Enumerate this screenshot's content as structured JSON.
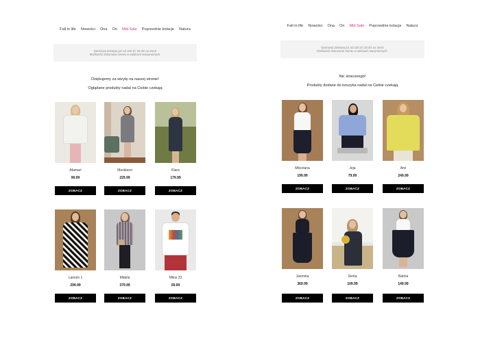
{
  "nav": {
    "items": [
      "Fall in life",
      "Nowości",
      "Ona",
      "On",
      "Mid Sale",
      "Poprzednie kolacje",
      "Natura"
    ],
    "highlight_index": 4,
    "highlight_color": "#e0308a"
  },
  "banner": {
    "line1": "Darmowa dostawa już od 100 zł | 30 dni na zwrot",
    "line2": "Możliwość dokonania zwrotu w salonach stacjonarnych."
  },
  "left_email": {
    "heading1": "Dziękujemy za wizytę na naszej stronie!",
    "heading2": "Oglądane produkty nadal na Ciebie czekają",
    "products": [
      {
        "name": "Afamari",
        "price": "99.99",
        "button": "ZOBACZ"
      },
      {
        "name": "Menikemi",
        "price": "229.99",
        "button": "ZOBACZ"
      },
      {
        "name": "Klara",
        "price": "179.99",
        "button": "ZOBACZ"
      },
      {
        "name": "Lamolo 1",
        "price": "299.99",
        "button": "ZOBACZ"
      },
      {
        "name": "Midela",
        "price": "379.99",
        "button": "ZOBACZ"
      },
      {
        "name": "Milos 23",
        "price": "59.99",
        "button": "ZOBACZ"
      }
    ]
  },
  "right_email": {
    "heading1": "Nic straconego!",
    "heading2": "Produkty dodane do koszyka nadal na Ciebie czekają",
    "products": [
      {
        "name": "Mikoriana",
        "price": "199.99",
        "button": "ZOBACZ"
      },
      {
        "name": "Jeja",
        "price": "79.99",
        "button": "ZOBACZ"
      },
      {
        "name": "Ami",
        "price": "249.99",
        "button": "ZOBACZ"
      },
      {
        "name": "Jasmina",
        "price": "369.99",
        "button": "ZOBACZ"
      },
      {
        "name": "Senta",
        "price": "109.99",
        "button": "ZOBACZ"
      },
      {
        "name": "Natola",
        "price": "149.99",
        "button": "ZOBACZ"
      }
    ]
  }
}
